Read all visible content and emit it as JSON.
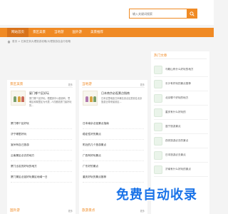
{
  "search": {
    "placeholder": "输入关键词搜索"
  },
  "nav": {
    "items": [
      {
        "label": "网站首页"
      },
      {
        "label": "景区美景"
      },
      {
        "label": "当地游"
      },
      {
        "label": "国外游"
      },
      {
        "label": "美景推荐"
      }
    ]
  },
  "breadcrumb": {
    "text": "首页 > 石家庄到大理旅游攻略/大理旅游自由行攻略"
  },
  "panel_left": {
    "title": "景区美景",
    "more": "更多",
    "feature_title": "厦门哪个区好玩",
    "feature_desc": "厦门哪个区好玩。根据其中以鼓浪屿、思明区和湖里区为代表, 人们都说厦门最好玩的...",
    "items": [
      "厦门哪个区好玩",
      "济宁哪里好玩",
      "宣州有自己旅游",
      "云南景区必去的地方",
      "厦门出名的好玩的地方",
      "厦门景区必逛好玩景区地域一日"
    ]
  },
  "panel_mid": {
    "title": "当地游",
    "more": "更多",
    "feature_title": "日本南京必逛景点指南",
    "feature_desc": "日本这里地处日本著名景点区是前往北京旅游业带来最景区...",
    "items": [
      "日本南京必逛景点指南",
      "稳定性好的景点",
      "附近的几个旅游景点",
      "广西有好玩景点",
      "广东好的景点",
      "重庆好玩的景点推荐"
    ]
  },
  "sidebar": {
    "title": "热门文章",
    "items": [
      "马鞍山有什么好玩的地方",
      "长沙有好玩的景点推荐",
      "北京哪个好玩的地方",
      "重庆有什么好玩的",
      "遂宁旅游景点",
      "西安旅游必去的景点",
      "日本旅游必去景点",
      "济南有什么好玩的景点"
    ]
  },
  "panel_bottom_left": {
    "title": "国外游",
    "more": "更多"
  },
  "panel_bottom_mid": {
    "title": "旅游景点",
    "more": "更多"
  },
  "overlay": {
    "text": "免费自动收录"
  },
  "colors": {
    "accent": "#f08a24",
    "accent_dark": "#d8721a",
    "overlay": "#1a73e8"
  }
}
